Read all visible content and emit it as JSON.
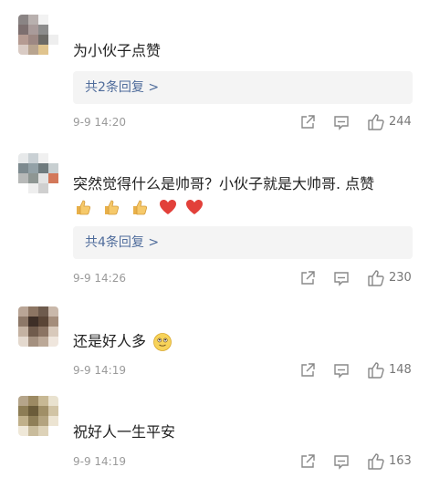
{
  "comments": [
    {
      "text": "为小伙子点赞",
      "reply": "共2条回复 >",
      "time": "9-9 14:20",
      "likes": "244",
      "avatar": [
        "#8a8484",
        "#b8b0ae",
        "#f2f2f2",
        "#ffffff",
        "#7d6f6f",
        "#a99b9a",
        "#8c8c8c",
        "#ffffff",
        "#b59b92",
        "#9d8883",
        "#6c6a66",
        "#eeeeee",
        "#d9cbc4",
        "#b8a48f",
        "#e0c48e",
        "#ffffff"
      ]
    },
    {
      "text": "突然觉得什么是帅哥？小伙子就是大帅哥. 点赞",
      "emojis": [
        "thumbs-up",
        "thumbs-up",
        "thumbs-up",
        "heart",
        "heart"
      ],
      "reply": "共4条回复 >",
      "time": "9-9 14:26",
      "likes": "230",
      "avatar": [
        "#e7e9ea",
        "#c9d0d4",
        "#f0f0f0",
        "#ffffff",
        "#7d8a8f",
        "#93a1a7",
        "#6f7b7e",
        "#c8cfd1",
        "#b7b9b8",
        "#8e9693",
        "#e3e3e3",
        "#d3785a",
        "#ffffff",
        "#eeeeee",
        "#cfcfcf",
        "#ffffff"
      ]
    },
    {
      "text": "还是好人多",
      "emojis": [
        "smiley"
      ],
      "time": "9-9 14:19",
      "likes": "148",
      "avatar": [
        "#b9a596",
        "#8c7563",
        "#6e5b4d",
        "#c9b8aa",
        "#8d7868",
        "#3e2f27",
        "#5a4536",
        "#a48d7b",
        "#c4b2a2",
        "#705b4c",
        "#8b7463",
        "#d8c9bb",
        "#e4d9ce",
        "#a4907f",
        "#bba897",
        "#efe6dd"
      ]
    },
    {
      "text": "祝好人一生平安",
      "time": "9-9 14:19",
      "likes": "163",
      "avatar": [
        "#b5a58a",
        "#9c8a63",
        "#c7b894",
        "#e9e2cf",
        "#8d7d55",
        "#6b5c3a",
        "#a08f67",
        "#d1c4a5",
        "#c0b08a",
        "#8f7f58",
        "#b3a37f",
        "#ece4d2",
        "#efe8d8",
        "#c9bc9c",
        "#ddd2b8",
        "#ffffff"
      ]
    }
  ],
  "icons": {
    "share": "share-icon",
    "comment": "comment-icon",
    "like": "thumbs-up-icon"
  }
}
